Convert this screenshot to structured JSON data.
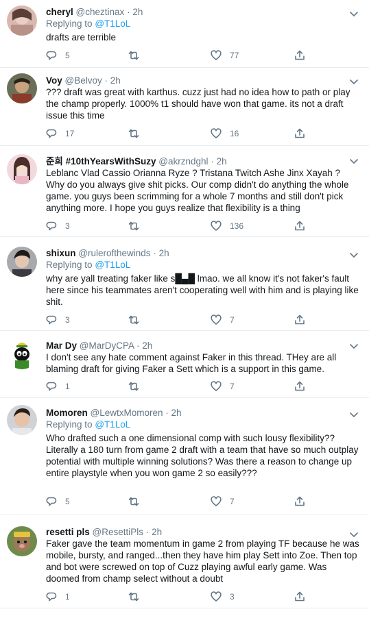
{
  "colors": {
    "accent": "#1da1f2",
    "secondary_text": "#657786",
    "divider": "#e6ecf0"
  },
  "tweets": [
    {
      "name": "cheryl",
      "handle": "@cheztinax",
      "time": "2h",
      "replying_prefix": "Replying to",
      "replying_to": "@T1LoL",
      "text": "drafts are terrible",
      "replies": "5",
      "retweets": "",
      "likes": "77"
    },
    {
      "name": "Voy",
      "handle": "@Belvoy",
      "time": "2h",
      "text": "??? draft was great with karthus. cuzz just had no idea how to path or play the champ properly. 1000% t1 should have won that game. its not a draft issue this time",
      "replies": "17",
      "retweets": "",
      "likes": "16"
    },
    {
      "name": "준희 #10thYearsWithSuzy",
      "handle": "@akrzndghl",
      "time": "2h",
      "text": "Leblanc Vlad Cassio Orianna Ryze ? Tristana Twitch Ashe Jinx Xayah ? Why do you always give shit picks. Our comp didn't do anything the whole game. you guys been scrimming for a whole 7 months and still don't pick anything more. I hope you guys realize that flexibility is a thing",
      "replies": "3",
      "retweets": "",
      "likes": "136"
    },
    {
      "name": "shixun",
      "handle": "@rulerofthewinds",
      "time": "2h",
      "replying_prefix": "Replying to",
      "replying_to": "@T1LoL",
      "text": "why are yall treating faker like s█▄█ lmao. we all know it's not faker's fault here since his teammates aren't cooperating well with him and is playing like shit.",
      "replies": "3",
      "retweets": "",
      "likes": "7"
    },
    {
      "name": "Mar Dy",
      "handle": "@MarDyCPA",
      "time": "2h",
      "text": "I don't see any hate comment against Faker in this thread. THey are all blaming draft for giving Faker a Sett which is a support in this game.",
      "replies": "1",
      "retweets": "",
      "likes": "7"
    },
    {
      "name": "Momoren",
      "handle": "@LewtxMomoren",
      "time": "2h",
      "replying_prefix": "Replying to",
      "replying_to": "@T1LoL",
      "text": "Who drafted such a one dimensional comp with such lousy flexibility?? Literally a 180 turn from game 2 draft with a team that have so much outplay potential with multiple winning solutions? Was there a reason to change up entire playstyle when you won game 2 so easily???",
      "replies": "5",
      "retweets": "",
      "likes": "7"
    },
    {
      "name": "resetti pls",
      "handle": "@ResettiPls",
      "time": "2h",
      "text": "Faker gave the team momentum in game 2 from playing TF because he was mobile, bursty, and ranged...then they have him play Sett into Zoe. Then top and bot were screwed on top of Cuzz playing awful early game. Was doomed from champ select without a doubt",
      "replies": "1",
      "retweets": "",
      "likes": "3"
    }
  ],
  "icons": [
    "reply-icon",
    "retweet-icon",
    "like-icon",
    "share-icon",
    "chevron-down-icon"
  ]
}
